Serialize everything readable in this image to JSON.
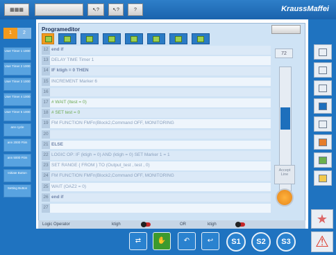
{
  "topbar": {
    "brand": "KraussMaffei",
    "btn_3_label": "?"
  },
  "leftbar": {
    "tab_a": "1",
    "tab_b": "2",
    "items": [
      "User Timer 1 1000",
      "User Timer 2 1000",
      "User Timer 3 1000",
      "User Timer 4 1000",
      "User Timer 5 1000",
      "ann cycle",
      "ann 2000 Ftim",
      "ann 5000 Ftim",
      "Initiate Button",
      "Setting Button"
    ]
  },
  "editor": {
    "title": "Programeditor",
    "line_counter": "72",
    "lines": [
      {
        "num": "12",
        "text": "end if",
        "style": "kw"
      },
      {
        "num": "13",
        "text": "DELAY TIME Timer 1",
        "style": ""
      },
      {
        "num": "14",
        "text": "IF ktigh = 0 THEN",
        "style": "kw"
      },
      {
        "num": "15",
        "text": "    INCREMENT Marker 6",
        "style": ""
      },
      {
        "num": "16",
        "text": "",
        "style": ""
      },
      {
        "num": "17",
        "text": "    # WAIT (Itest = 0)",
        "style": "green"
      },
      {
        "num": "18",
        "text": "    # SET test = 0",
        "style": "green"
      },
      {
        "num": "19",
        "text": "    FM FUNCTION FMFn(Block2,Command OFF,  MONITORING",
        "style": ""
      },
      {
        "num": "20",
        "text": "",
        "style": ""
      },
      {
        "num": "21",
        "text": "ELSE",
        "style": "kw"
      },
      {
        "num": "22",
        "text": "    LOGIC OP: IF (ktigh = 0) AND (ktigh = 0) SET Marker 1 = 1",
        "style": ""
      },
      {
        "num": "23",
        "text": "    SET RANGE { FROM } TO (Output_test , test , 0)",
        "style": ""
      },
      {
        "num": "24",
        "text": "    FM FUNCTION FMFn(Block2,Command OFF,  MONITORING",
        "style": ""
      },
      {
        "num": "25",
        "text": "    WAIT (OAZ2 = 0)",
        "style": ""
      },
      {
        "num": "26",
        "text": "end if",
        "style": "kw"
      },
      {
        "num": "27",
        "text": "",
        "style": ""
      }
    ],
    "side_button_1": "Accept Line",
    "scroll_fraction": 0.32
  },
  "params": {
    "label": "Logic Operator",
    "left_select": "ktigh",
    "or_label": "OR",
    "right_select": "ktigh"
  },
  "bottom": {
    "circle_1": "S1",
    "circle_2": "S2",
    "circle_3": "S3"
  },
  "rightbar": {
    "star": "★",
    "warn": "⚠"
  }
}
